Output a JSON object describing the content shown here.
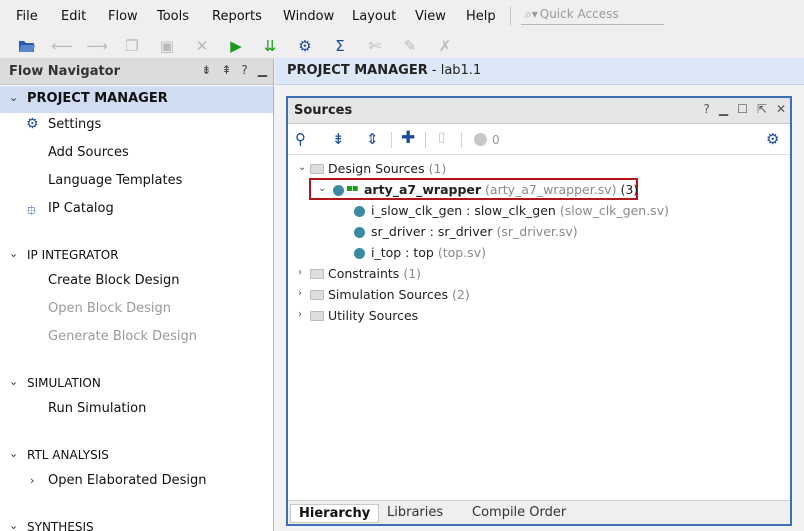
{
  "menubar": {
    "items": [
      "File",
      "Edit",
      "Flow",
      "Tools",
      "Reports",
      "Window",
      "Layout",
      "View",
      "Help"
    ],
    "search_placeholder": "Quick Access"
  },
  "flow_navigator": {
    "title": "Flow Navigator",
    "sections": [
      {
        "label": "PROJECT MANAGER",
        "items": [
          {
            "label": "Settings",
            "icon": "gear-icon",
            "enabled": true
          },
          {
            "label": "Add Sources",
            "enabled": true
          },
          {
            "label": "Language Templates",
            "enabled": true
          },
          {
            "label": "IP Catalog",
            "icon": "ip-catalog-icon",
            "enabled": true
          }
        ]
      },
      {
        "label": "IP INTEGRATOR",
        "items": [
          {
            "label": "Create Block Design",
            "enabled": true
          },
          {
            "label": "Open Block Design",
            "enabled": false
          },
          {
            "label": "Generate Block Design",
            "enabled": false
          }
        ]
      },
      {
        "label": "SIMULATION",
        "items": [
          {
            "label": "Run Simulation",
            "enabled": true
          }
        ]
      },
      {
        "label": "RTL ANALYSIS",
        "items": [
          {
            "label": "Open Elaborated Design",
            "enabled": true
          }
        ]
      },
      {
        "label": "SYNTHESIS",
        "items": []
      }
    ]
  },
  "project_manager": {
    "label": "PROJECT MANAGER",
    "project": " - lab1.1"
  },
  "sources": {
    "title": "Sources",
    "toolbar_count": "0",
    "tree": {
      "design_sources": {
        "label": "Design Sources",
        "count": "(1)"
      },
      "top": {
        "name": "arty_a7_wrapper",
        "file": "(arty_a7_wrapper.sv)",
        "count": "(3)"
      },
      "children": [
        {
          "name": "i_slow_clk_gen : slow_clk_gen",
          "file": "(slow_clk_gen.sv)"
        },
        {
          "name": "sr_driver : sr_driver",
          "file": "(sr_driver.sv)"
        },
        {
          "name": "i_top : top",
          "file": "(top.sv)"
        }
      ],
      "constraints": {
        "label": "Constraints",
        "count": "(1)"
      },
      "simulation_sources": {
        "label": "Simulation Sources",
        "count": "(2)"
      },
      "utility_sources": {
        "label": "Utility Sources"
      }
    },
    "tabs": [
      "Hierarchy",
      "Libraries",
      "Compile Order"
    ],
    "active_tab": "Hierarchy"
  },
  "colors": {
    "accent_blue": "#1b4a9c",
    "selected_section": "#cfdcf1",
    "highlight_red": "#b0161b",
    "module_dot": "#3a8aa3",
    "run_green": "#1a9a1a"
  }
}
